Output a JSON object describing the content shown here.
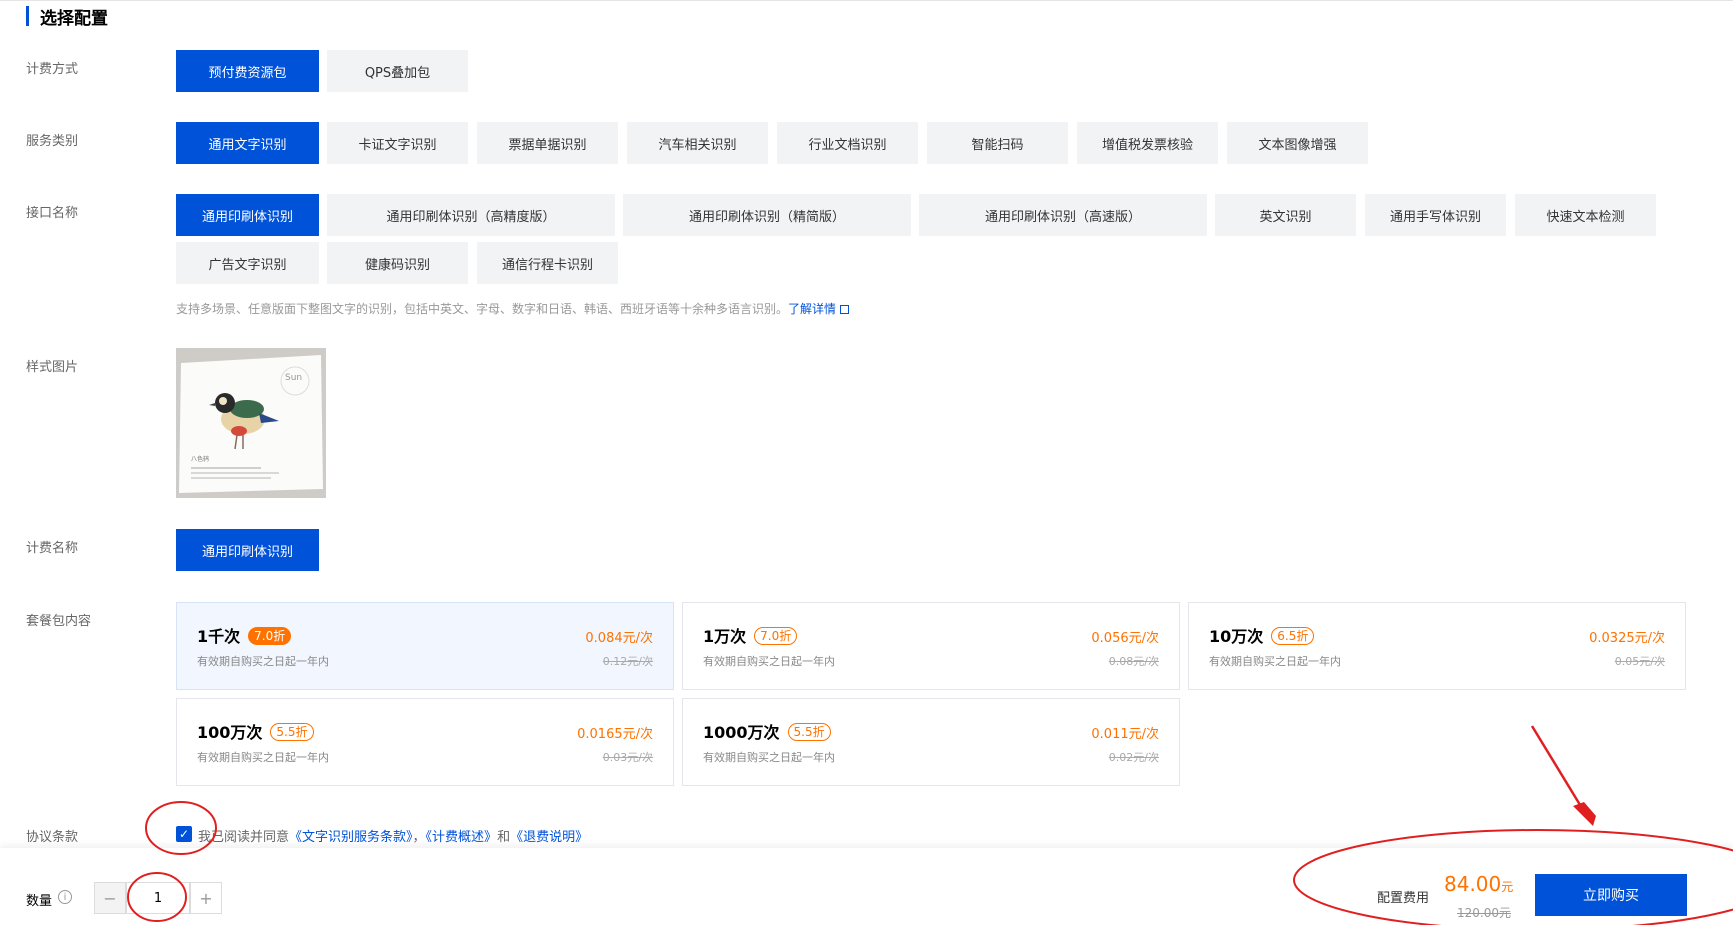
{
  "section_title": "选择配置",
  "labels": {
    "billing_mode": "计费方式",
    "service_type": "服务类别",
    "api_name": "接口名称",
    "sample_image": "样式图片",
    "billing_name": "计费名称",
    "package": "套餐包内容",
    "agreement": "协议条款",
    "quantity": "数量"
  },
  "billing_modes": [
    "预付费资源包",
    "QPS叠加包"
  ],
  "service_types": [
    "通用文字识别",
    "卡证文字识别",
    "票据单据识别",
    "汽车相关识别",
    "行业文档识别",
    "智能扫码",
    "增值税发票核验",
    "文本图像增强"
  ],
  "api_names": [
    "通用印刷体识别",
    "通用印刷体识别（高精度版）",
    "通用印刷体识别（精简版）",
    "通用印刷体识别（高速版）",
    "英文识别",
    "通用手写体识别",
    "快速文本检测",
    "广告文字识别",
    "健康码识别",
    "通信行程卡识别"
  ],
  "api_description": "支持多场景、任意版面下整图文字的识别，包括中英文、字母、数字和日语、韩语、西班牙语等十余种多语言识别。",
  "api_description_link": "了解详情",
  "sample_image_text": {
    "sun": "Sun",
    "caption": "八色鸫"
  },
  "billing_name": "通用印刷体识别",
  "packages": [
    {
      "count": "1千次",
      "discount": "7.0折",
      "price": "0.084元/次",
      "orig": "0.12元/次",
      "valid": "有效期自购买之日起一年内"
    },
    {
      "count": "1万次",
      "discount": "7.0折",
      "price": "0.056元/次",
      "orig": "0.08元/次",
      "valid": "有效期自购买之日起一年内"
    },
    {
      "count": "10万次",
      "discount": "6.5折",
      "price": "0.0325元/次",
      "orig": "0.05元/次",
      "valid": "有效期自购买之日起一年内"
    },
    {
      "count": "100万次",
      "discount": "5.5折",
      "price": "0.0165元/次",
      "orig": "0.03元/次",
      "valid": "有效期自购买之日起一年内"
    },
    {
      "count": "1000万次",
      "discount": "5.5折",
      "price": "0.011元/次",
      "orig": "0.02元/次",
      "valid": "有效期自购买之日起一年内"
    }
  ],
  "agreement": {
    "prefix": "我已阅读并同意",
    "link1": "《文字识别服务条款》",
    "sep": "，",
    "link2": "《计费概述》",
    "and": "和",
    "link3": "《退费说明》"
  },
  "quantity": {
    "value": "1",
    "minus": "−",
    "plus": "+"
  },
  "fee": {
    "label": "配置费用",
    "price": "84.00",
    "unit": "元",
    "orig": "120.00元"
  },
  "buy_label": "立即购买",
  "colors": {
    "primary": "#0052d9",
    "accent": "#ff7200",
    "annotation": "#e02020"
  }
}
